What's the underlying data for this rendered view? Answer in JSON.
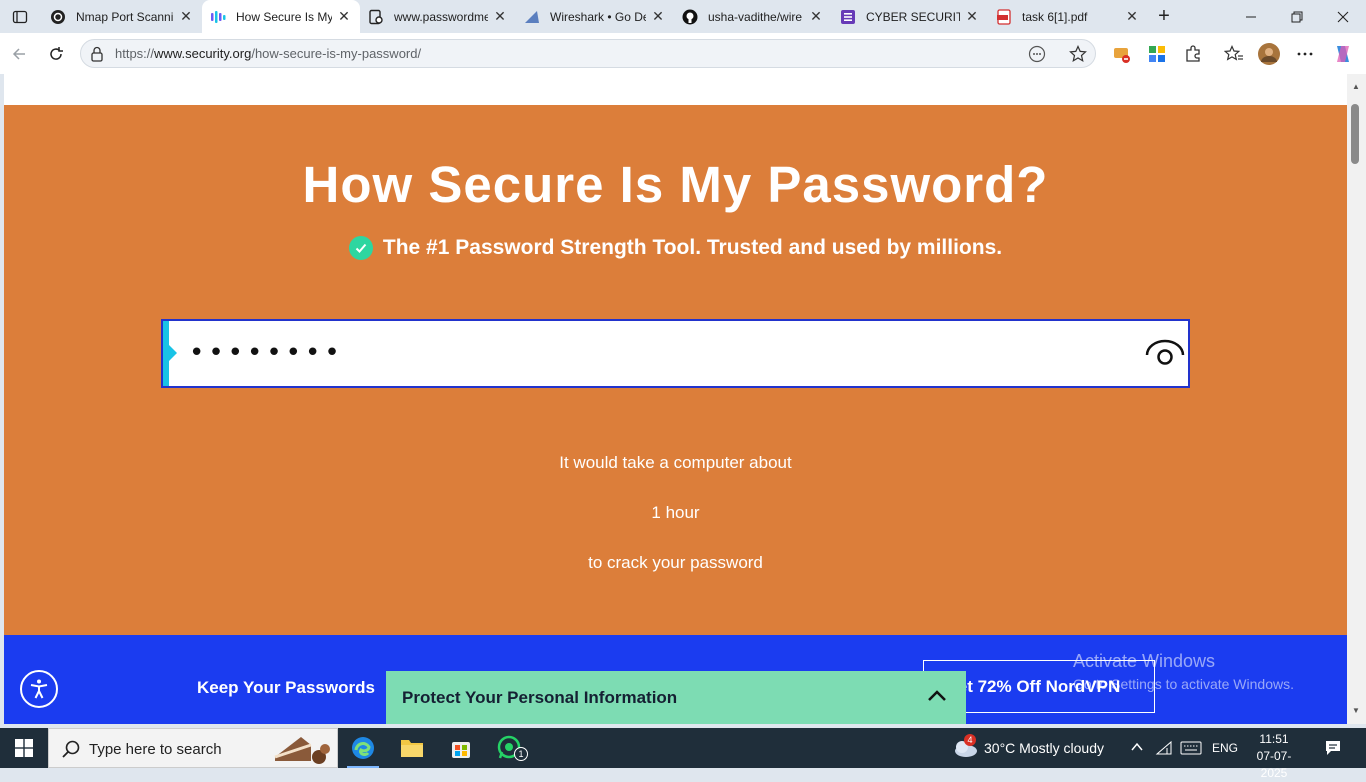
{
  "browser": {
    "tabs": [
      {
        "title": "Nmap Port Scanni",
        "icon": "nmap-icon",
        "active": false
      },
      {
        "title": "How Secure Is My",
        "icon": "security-org-icon",
        "active": true
      },
      {
        "title": "www.passwordme",
        "icon": "page-link-icon",
        "active": false
      },
      {
        "title": "Wireshark • Go De",
        "icon": "wireshark-icon",
        "active": false
      },
      {
        "title": "usha-vadithe/wire",
        "icon": "github-icon",
        "active": false
      },
      {
        "title": "CYBER SECURITY T",
        "icon": "forms-icon",
        "active": false
      },
      {
        "title": "task 6[1].pdf",
        "icon": "pdf-icon",
        "active": false
      }
    ],
    "address": {
      "prefix": "https://",
      "domain": "www.security.org",
      "path": "/how-secure-is-my-password/"
    }
  },
  "page": {
    "title": "How Secure Is My Password?",
    "subtitle": "The #1 Password Strength Tool. Trusted and used by millions.",
    "password_value": "••••••••",
    "result_line1": "It would take a computer about",
    "result_time": "1 hour",
    "result_line3": "to crack your password",
    "keep_text": "Keep Your Passwords",
    "nord_button": "et 72% Off NordVPN",
    "protect_banner": "Protect Your Personal Information"
  },
  "watermark": {
    "line1": "Activate Windows",
    "line2": "Go to Settings to activate Windows."
  },
  "taskbar": {
    "search_placeholder": "Type here to search",
    "weather": "30°C  Mostly cloudy",
    "weather_badge": "4",
    "language": "ENG",
    "time": "11:51",
    "date": "07-07-2025",
    "whatsapp_badge": "1"
  },
  "colors": {
    "hero_orange": "#dc7e3a",
    "blue_bar": "#1b3cf0",
    "protect_green": "#7ddcb3",
    "accent_cyan": "#19c3e6"
  }
}
